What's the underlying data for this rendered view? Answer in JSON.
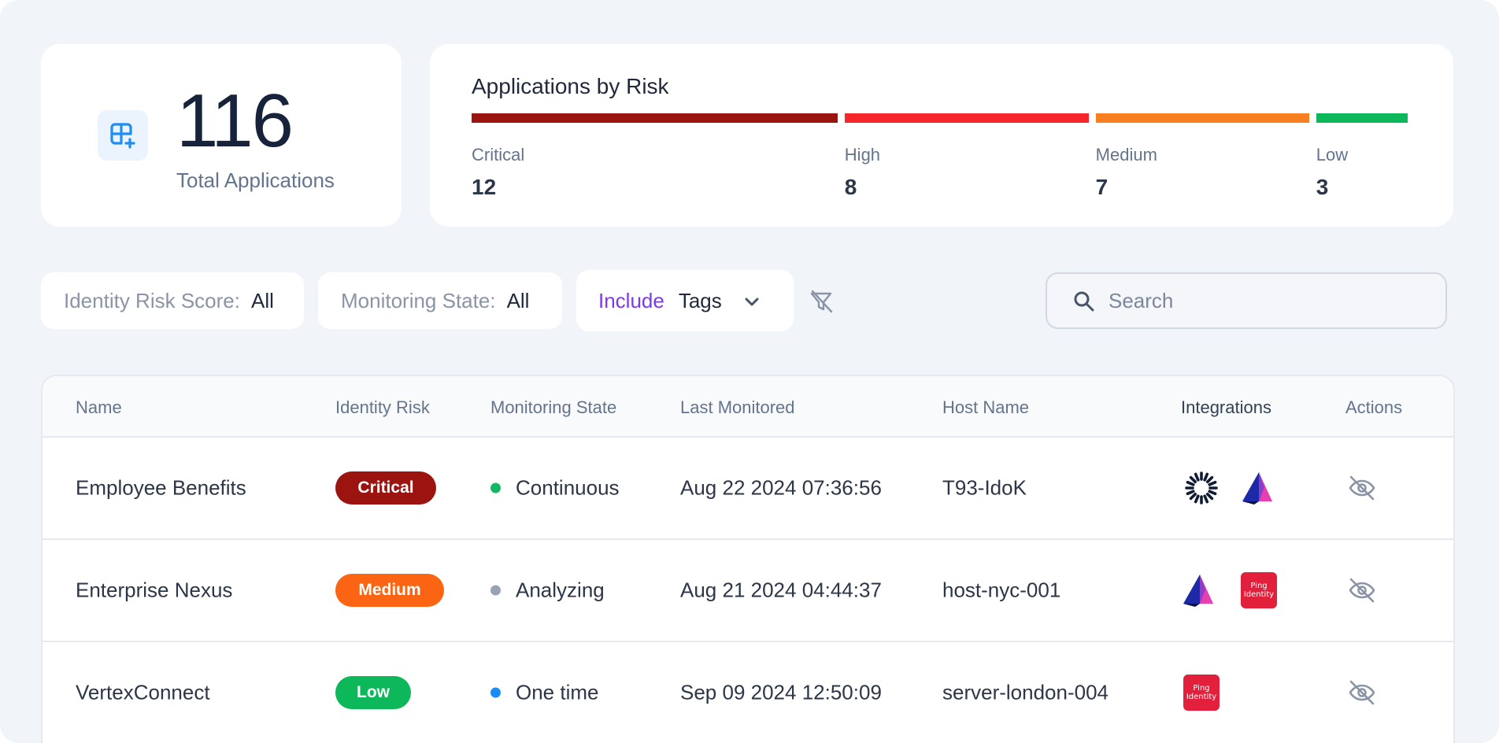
{
  "colors": {
    "critical": "#9b1410",
    "high": "#f5272b",
    "medium": "#f88020",
    "low": "#0cb85a",
    "accent": "#7c3aed",
    "icon_blue": "#1f8ef0"
  },
  "summary": {
    "total_value": "116",
    "total_label": "Total Applications",
    "icon": "grid-plus-icon"
  },
  "risk": {
    "title": "Applications by Risk",
    "categories": [
      {
        "label": "Critical",
        "value": "12",
        "color": "#9b1410"
      },
      {
        "label": "High",
        "value": "8",
        "color": "#f5272b"
      },
      {
        "label": "Medium",
        "value": "7",
        "color": "#f88020"
      },
      {
        "label": "Low",
        "value": "3",
        "color": "#0cb85a"
      }
    ]
  },
  "filters": {
    "identity_risk": {
      "label": "Identity Risk Score:",
      "value": "All"
    },
    "monitoring_state": {
      "label": "Monitoring State:",
      "value": "All"
    },
    "tags": {
      "mode": "Include",
      "label": "Tags",
      "icon": "chevron-down-icon"
    },
    "clear_icon": "filter-clear-icon"
  },
  "search": {
    "placeholder": "Search",
    "value": "",
    "icon": "search-icon"
  },
  "table": {
    "columns": [
      "Name",
      "Identity Risk",
      "Monitoring State",
      "Last Monitored",
      "Host Name",
      "Integrations",
      "Actions"
    ],
    "rows": [
      {
        "name": "Employee Benefits",
        "risk": "Critical",
        "risk_color": "#9b1410",
        "state": "Continuous",
        "state_color": "#13b862",
        "last_monitored": "Aug 22 2024 07:36:56",
        "host": "T93-IdoK",
        "integrations": [
          "sunburst-logo-icon",
          "prism-logo-icon"
        ],
        "action_icon": "eye-off-icon"
      },
      {
        "name": "Enterprise Nexus",
        "risk": "Medium",
        "risk_color": "#fb6412",
        "state": "Analyzing",
        "state_color": "#98a2b3",
        "last_monitored": "Aug 21 2024 04:44:37",
        "host": "host-nyc-001",
        "integrations": [
          "prism-logo-icon",
          "ping-identity-logo-icon"
        ],
        "action_icon": "eye-off-icon"
      },
      {
        "name": "VertexConnect",
        "risk": "Low",
        "risk_color": "#0cb85a",
        "state": "One time",
        "state_color": "#1a8cf5",
        "last_monitored": "Sep 09 2024 12:50:09",
        "host": "server-london-004",
        "integrations": [
          "ping-identity-logo-icon"
        ],
        "action_icon": "eye-off-icon"
      }
    ]
  },
  "ping_logo": {
    "line1": "Ping",
    "line2": "Identity"
  }
}
